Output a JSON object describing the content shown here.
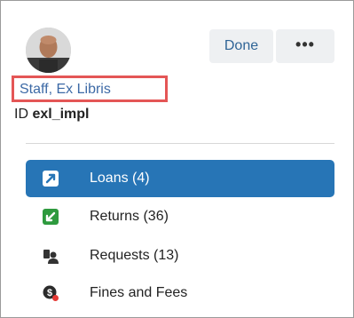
{
  "profile": {
    "avatar_icon": "user-avatar",
    "name": "Staff, Ex Libris",
    "id_prefix": "ID",
    "id_value": "exl_impl"
  },
  "toolbar": {
    "done_label": "Done",
    "more_label": "•••"
  },
  "menu": {
    "items": [
      {
        "icon": "loans-icon",
        "label": "Loans (4)",
        "active": true
      },
      {
        "icon": "returns-icon",
        "label": "Returns (36)",
        "active": false
      },
      {
        "icon": "requests-icon",
        "label": "Requests (13)",
        "active": false
      },
      {
        "icon": "fines-icon",
        "label": "Fines and Fees",
        "active": false
      }
    ]
  },
  "colors": {
    "accent": "#2775b6",
    "highlight_border": "#e45656",
    "link": "#3d6aa6",
    "returns_green": "#2e9a3e"
  }
}
